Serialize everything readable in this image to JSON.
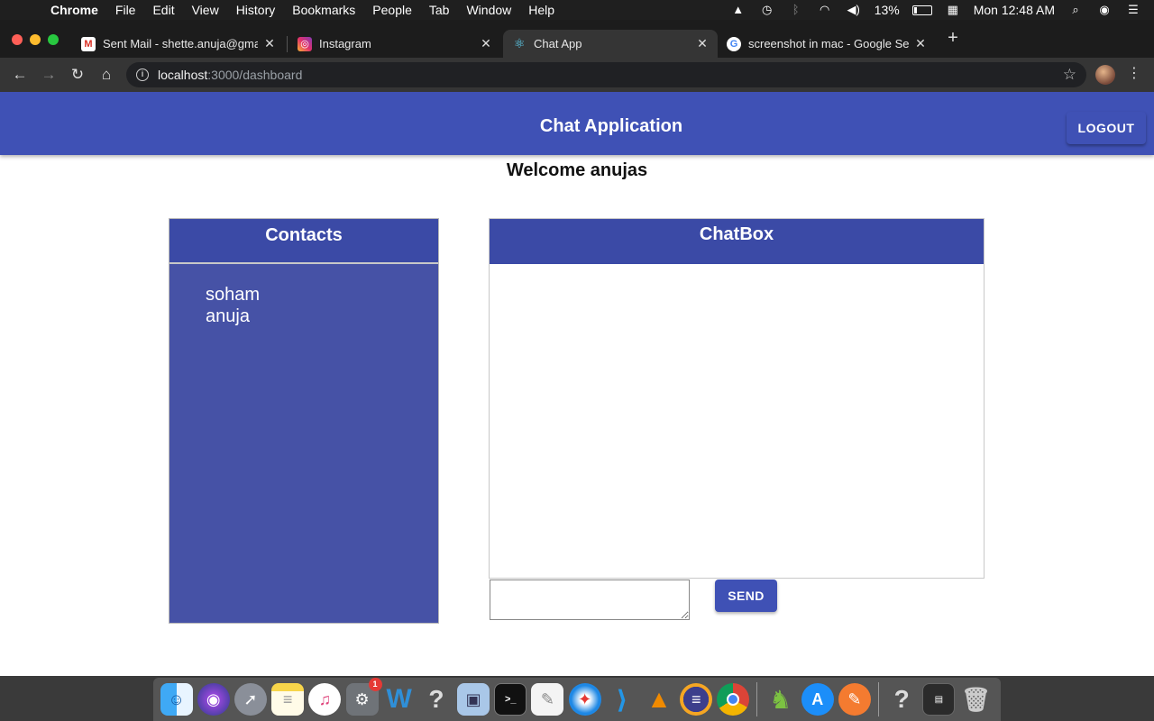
{
  "menubar": {
    "app_name": "Chrome",
    "items": [
      "File",
      "Edit",
      "View",
      "History",
      "Bookmarks",
      "People",
      "Tab",
      "Window",
      "Help"
    ],
    "battery": "13%",
    "clock": "Mon 12:48 AM"
  },
  "tabs": [
    {
      "title": "Sent Mail - shette.anuja@gmail.com",
      "icon": "gmail-icon"
    },
    {
      "title": "Instagram",
      "icon": "instagram-icon"
    },
    {
      "title": "Chat App",
      "icon": "react-icon"
    },
    {
      "title": "screenshot in mac - Google Search",
      "icon": "google-icon"
    }
  ],
  "address": {
    "host": "localhost",
    "path": ":3000/dashboard"
  },
  "app": {
    "title": "Chat Application",
    "logout_label": "LOGOUT",
    "welcome": "Welcome anujas",
    "contacts_title": "Contacts",
    "contacts": [
      "soham",
      "anuja"
    ],
    "chatbox_title": "ChatBox",
    "message_value": "",
    "send_label": "SEND"
  },
  "colors": {
    "primary": "#3f51b5",
    "contacts_bg": "#4652a6"
  },
  "dock": {
    "apps": [
      "Finder",
      "Siri",
      "Launchpad",
      "Notes",
      "iTunes",
      "System Preferences",
      "Word",
      "Unknown",
      "Preview",
      "Terminal",
      "TextEdit",
      "Safari",
      "VS Code",
      "VLC",
      "Eclipse",
      "Chrome",
      "Android Studio",
      "App Store",
      "Pages",
      "Unknown",
      "Screenshot",
      "Trash"
    ],
    "system_prefs_badge": "1"
  }
}
